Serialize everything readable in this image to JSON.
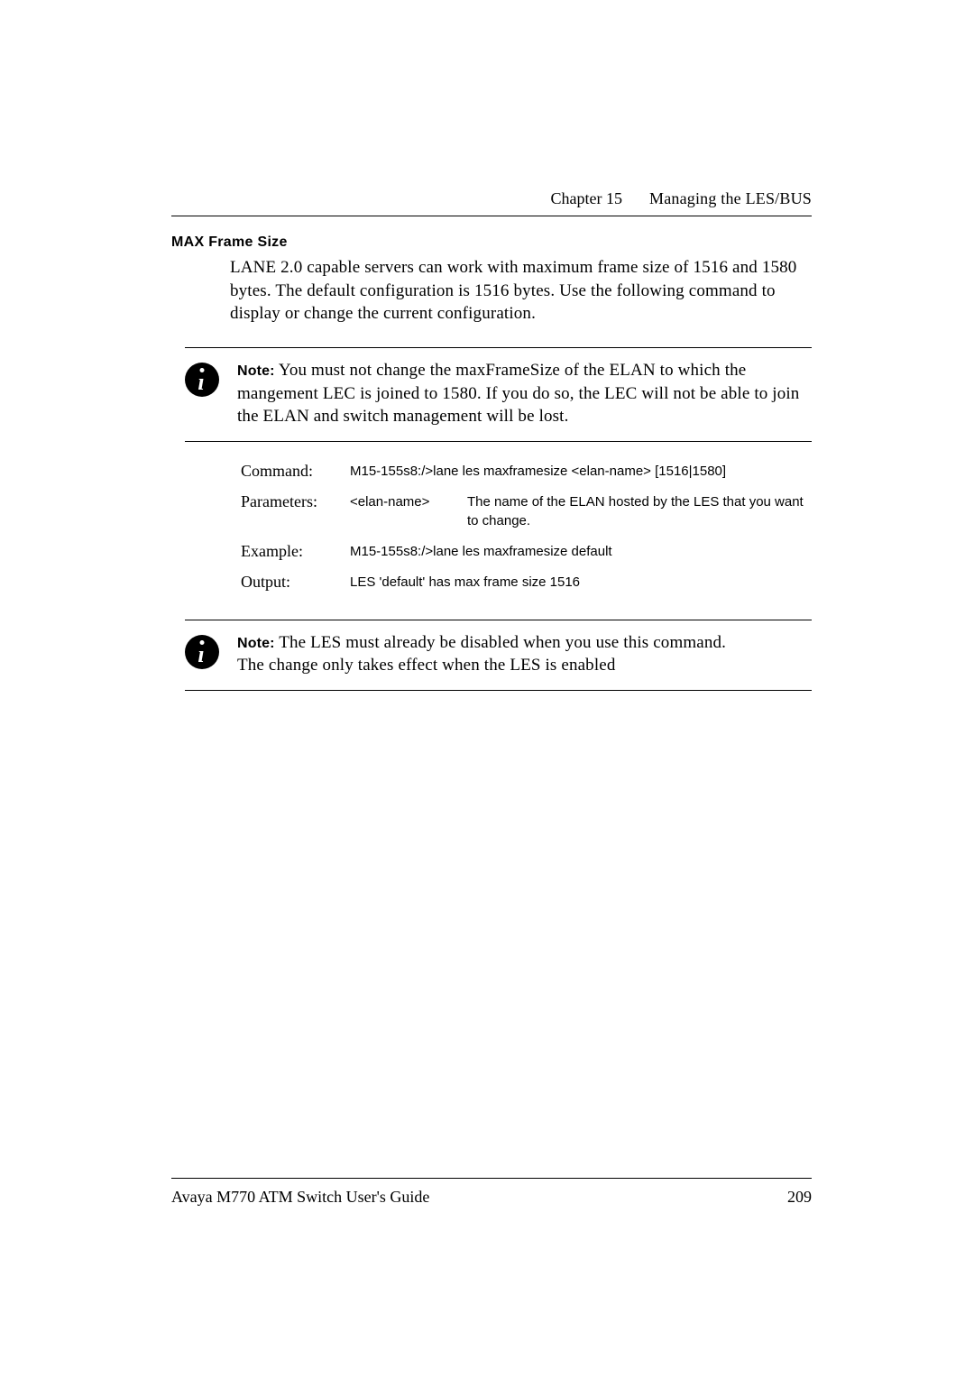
{
  "header": {
    "chapter_label": "Chapter 15",
    "chapter_title": "Managing the LES/BUS"
  },
  "section": {
    "heading": "MAX Frame Size",
    "intro": "LANE 2.0 capable servers can work with maximum frame size of 1516 and 1580 bytes. The default configuration is 1516 bytes.  Use the following command to display or change the current configuration."
  },
  "note1": {
    "label": "Note:",
    "text": "You must not change the maxFrameSize of the ELAN to which the mangement LEC is joined to 1580. If you do so, the LEC will not be able to join the ELAN and switch management will be lost."
  },
  "cmd": {
    "command_label": "Command:",
    "command_value": "M15-155s8:/>lane les maxframesize <elan-name> [1516|1580]",
    "parameters_label": "Parameters:",
    "param_name": "<elan-name>",
    "param_desc": "The name of the ELAN hosted by the LES that you want to change.",
    "example_label": "Example:",
    "example_value": "M15-155s8:/>lane les maxframesize default",
    "output_label": "Output:",
    "output_value": "LES 'default' has max frame size 1516"
  },
  "note2": {
    "label": "Note:",
    "line1": "The LES must already be disabled when you use this command.",
    "line2": "The change only takes effect when the LES is enabled"
  },
  "footer": {
    "doc_title": "Avaya M770 ATM Switch User's Guide",
    "page_number": "209"
  }
}
